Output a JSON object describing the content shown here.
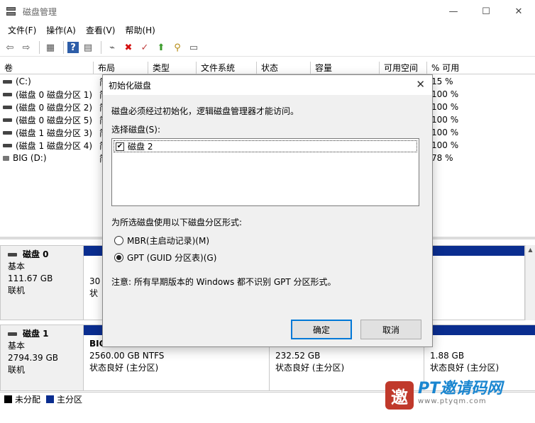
{
  "window": {
    "title": "磁盘管理",
    "minimize": "—",
    "maximize": "☐",
    "close": "✕"
  },
  "menu": [
    "文件(F)",
    "操作(A)",
    "查看(V)",
    "帮助(H)"
  ],
  "toolbar": {
    "icons": [
      "back-arrow-icon",
      "forward-arrow-icon",
      "list-view-icon",
      "help-icon",
      "properties-icon",
      "connect-icon",
      "delete-icon",
      "check-icon",
      "folder-up-icon",
      "search-icon",
      "console-icon"
    ],
    "glyphs": [
      "⇦",
      "⇨",
      "▦",
      "?",
      "▤",
      "⌁",
      "✖",
      "✓",
      "⬆",
      "⚲",
      "▭"
    ]
  },
  "columns": [
    "卷",
    "布局",
    "类型",
    "文件系统",
    "状态",
    "容量",
    "可用空间",
    "% 可用"
  ],
  "volumes": [
    {
      "name": "(C:)",
      "layout": "简",
      "pct": "15 %"
    },
    {
      "name": "(磁盘 0 磁盘分区 1)",
      "layout": "简",
      "pct": "100 %"
    },
    {
      "name": "(磁盘 0 磁盘分区 2)",
      "layout": "简",
      "pct": "100 %"
    },
    {
      "name": "(磁盘 0 磁盘分区 5)",
      "layout": "简",
      "pct": "100 %"
    },
    {
      "name": "(磁盘 1 磁盘分区 3)",
      "layout": "简",
      "pct": "100 %"
    },
    {
      "name": "(磁盘 1 磁盘分区 4)",
      "layout": "简",
      "pct": "100 %"
    },
    {
      "name": "BIG (D:)",
      "layout": "简",
      "pct": "78 %"
    }
  ],
  "disks": [
    {
      "name": "磁盘 0",
      "type": "基本",
      "size": "111.67 GB",
      "status": "联机",
      "partitions": [
        {
          "line1": "30",
          "line2": "状"
        }
      ]
    },
    {
      "name": "磁盘 1",
      "type": "基本",
      "size": "2794.39 GB",
      "status": "联机",
      "partitions": [
        {
          "line0": "BIG",
          "line1": "2560.00 GB NTFS",
          "line2": "状态良好 (主分区)"
        },
        {
          "line1": "232.52 GB",
          "line2": "状态良好 (主分区)"
        },
        {
          "line1": "1.88 GB",
          "line2": "状态良好 (主分区)"
        }
      ]
    }
  ],
  "legend": [
    {
      "label": "未分配",
      "color": "#000000"
    },
    {
      "label": "主分区",
      "color": "#0a2d8f"
    }
  ],
  "dialog": {
    "title": "初始化磁盘",
    "intro": "磁盘必须经过初始化，逻辑磁盘管理器才能访问。",
    "select_label": "选择磁盘(S):",
    "disk_item": "磁盘 2",
    "disk_checked": true,
    "style_label": "为所选磁盘使用以下磁盘分区形式:",
    "options": [
      {
        "label": "MBR(主启动记录)(M)",
        "selected": false
      },
      {
        "label": "GPT (GUID 分区表)(G)",
        "selected": true
      }
    ],
    "note": "注意: 所有早期版本的 Windows 都不识别 GPT 分区形式。",
    "ok": "确定",
    "cancel": "取消"
  },
  "watermark": {
    "logo": "邀",
    "main": "PT邀请码网",
    "sub": "www.ptyqm.com"
  }
}
